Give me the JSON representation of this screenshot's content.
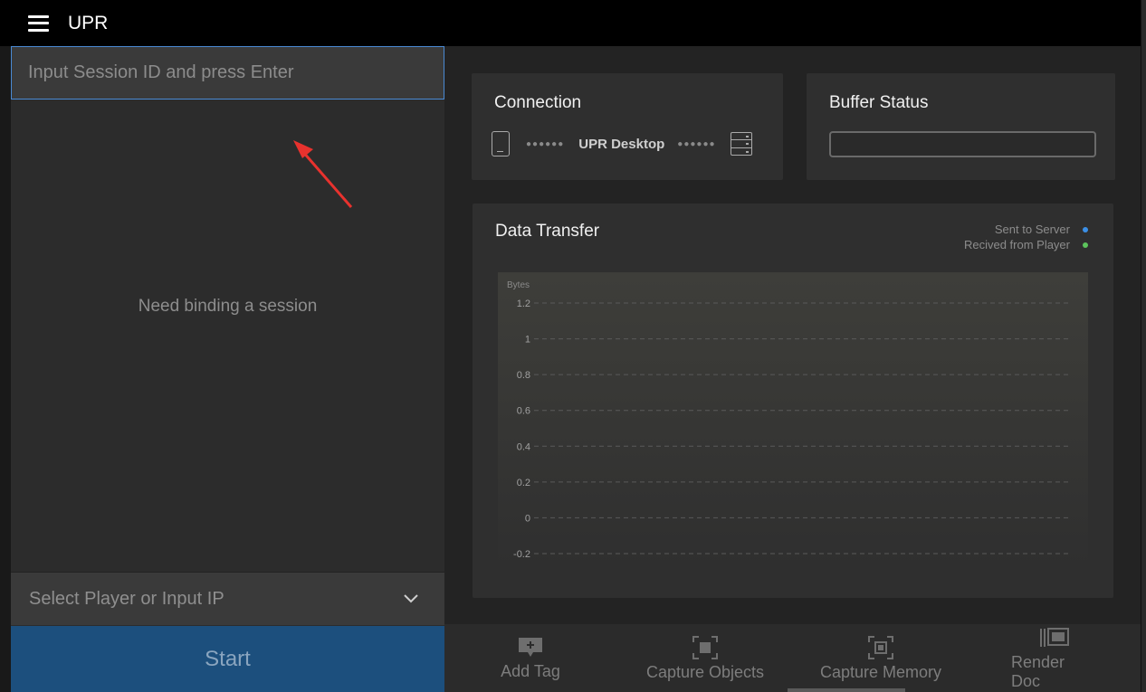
{
  "app": {
    "title": "UPR"
  },
  "session": {
    "placeholder": "Input Session ID and press Enter",
    "empty_message": "Need binding a session"
  },
  "player_select": {
    "placeholder": "Select Player or Input IP"
  },
  "start_button": {
    "label": "Start"
  },
  "connection": {
    "title": "Connection",
    "device_label": "UPR Desktop"
  },
  "buffer": {
    "title": "Buffer Status"
  },
  "data_transfer": {
    "title": "Data Transfer",
    "legend": [
      {
        "label": "Sent to Server",
        "color": "#3b8fe6"
      },
      {
        "label": "Recived from Player",
        "color": "#5cc45c"
      }
    ]
  },
  "chart_data": {
    "type": "line",
    "ylabel": "Bytes",
    "yticks": [
      "1.2",
      "1",
      "0.8",
      "0.6",
      "0.4",
      "0.2",
      "0",
      "-0.2"
    ],
    "ylim": [
      -0.2,
      1.2
    ],
    "grid": true,
    "series": []
  },
  "toolbar": {
    "add_tag": "Add Tag",
    "capture_objects": "Capture Objects",
    "capture_memory": "Capture Memory",
    "render_doc": "Render Doc"
  }
}
